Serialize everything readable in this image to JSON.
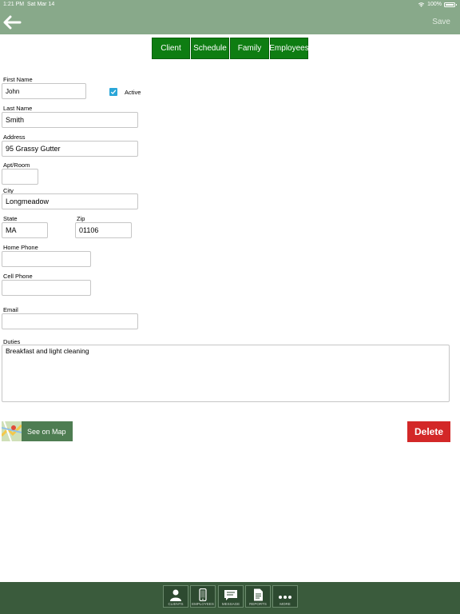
{
  "status": {
    "time": "1:21 PM",
    "date": "Sat Mar 14",
    "battery": "100%"
  },
  "nav": {
    "save_label": "Save"
  },
  "tabs": [
    {
      "label": "Client"
    },
    {
      "label": "Schedule"
    },
    {
      "label": "Family"
    },
    {
      "label": "Employees"
    }
  ],
  "form": {
    "first_name": {
      "label": "First Name",
      "value": "John"
    },
    "active": {
      "label": "Active",
      "checked": true
    },
    "last_name": {
      "label": "Last Name",
      "value": "Smith"
    },
    "address": {
      "label": "Address",
      "value": "95 Grassy Gutter"
    },
    "apt": {
      "label": "Apt/Room",
      "value": ""
    },
    "city": {
      "label": "City",
      "value": "Longmeadow"
    },
    "state": {
      "label": "State",
      "value": "MA"
    },
    "zip": {
      "label": "Zip",
      "value": "01106"
    },
    "home_phone": {
      "label": "Home Phone",
      "value": ""
    },
    "cell_phone": {
      "label": "Cell Phone",
      "value": ""
    },
    "email": {
      "label": "Email",
      "value": ""
    },
    "duties": {
      "label": "Duties",
      "value": "Breakfast and light cleaning"
    }
  },
  "actions": {
    "map_label": "See on Map",
    "delete_label": "Delete"
  },
  "tabbar": [
    {
      "label": "CLIENTS",
      "icon": "person-icon"
    },
    {
      "label": "EMPLOYEES",
      "icon": "phone-icon"
    },
    {
      "label": "MESSAGE",
      "icon": "message-icon"
    },
    {
      "label": "REPORTS",
      "icon": "document-icon"
    },
    {
      "label": "MORE",
      "icon": "more-icon"
    }
  ],
  "colors": {
    "header": "#88a98a",
    "tab_green": "#0e7d12",
    "tabbar": "#3a5b3c",
    "delete": "#d32828",
    "checkbox": "#2aa6d8"
  }
}
